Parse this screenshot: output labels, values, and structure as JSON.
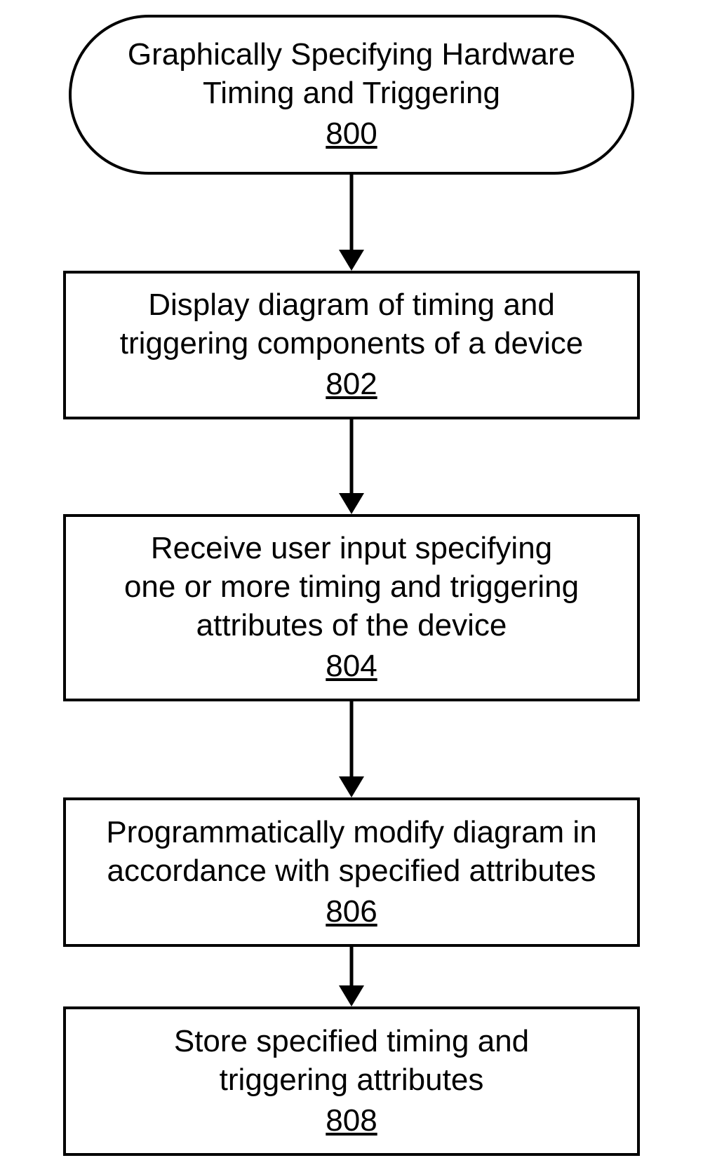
{
  "diagram": {
    "type": "flowchart",
    "nodes": [
      {
        "id": "n800",
        "shape": "terminator",
        "text": "Graphically Specifying Hardware\nTiming and Triggering",
        "ref": "800"
      },
      {
        "id": "n802",
        "shape": "process",
        "text": "Display diagram of timing and\ntriggering components of a device",
        "ref": "802"
      },
      {
        "id": "n804",
        "shape": "process",
        "text": "Receive user input specifying\none or more timing and triggering\nattributes of the device",
        "ref": "804"
      },
      {
        "id": "n806",
        "shape": "process",
        "text": "Programmatically modify diagram in\naccordance with specified attributes",
        "ref": "806"
      },
      {
        "id": "n808",
        "shape": "process",
        "text": "Store specified timing and\ntriggering attributes",
        "ref": "808"
      }
    ],
    "edges": [
      {
        "from": "n800",
        "to": "n802"
      },
      {
        "from": "n802",
        "to": "n804"
      },
      {
        "from": "n804",
        "to": "n806"
      },
      {
        "from": "n806",
        "to": "n808"
      }
    ]
  }
}
